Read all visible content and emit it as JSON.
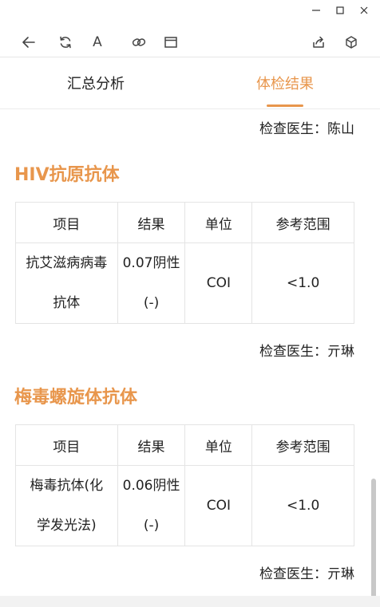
{
  "window": {
    "min_icon": "minimize-icon",
    "max_icon": "maximize-icon",
    "close_icon": "close-icon"
  },
  "toolbar": {
    "icons": [
      "back-arrow-icon",
      "refresh-icon",
      "font-size-icon",
      "link-icon",
      "window-icon",
      "share-icon",
      "cube-icon"
    ],
    "font_label": "A"
  },
  "tabs": [
    {
      "label": "汇总分析",
      "active": false
    },
    {
      "label": "体检结果",
      "active": true
    }
  ],
  "accent_color": "#e8964c",
  "sections": [
    {
      "doctor_above": "检查医生：陈山",
      "title": "HIV抗原抗体",
      "headers": [
        "项目",
        "结果",
        "单位",
        "参考范围"
      ],
      "row": {
        "item_line1": "抗艾滋病病毒",
        "item_line2": "抗体",
        "result_line1": "0.07阴性",
        "result_line2": "(-)",
        "unit": "COI",
        "range": "<1.0"
      },
      "doctor": "检查医生：亓琳"
    },
    {
      "title": "梅毒螺旋体抗体",
      "headers": [
        "项目",
        "结果",
        "单位",
        "参考范围"
      ],
      "row": {
        "item_line1": "梅毒抗体(化",
        "item_line2": "学发光法)",
        "result_line1": "0.06阴性",
        "result_line2": "(-)",
        "unit": "COI",
        "range": "<1.0"
      },
      "doctor": "检查医生：亓琳"
    }
  ]
}
